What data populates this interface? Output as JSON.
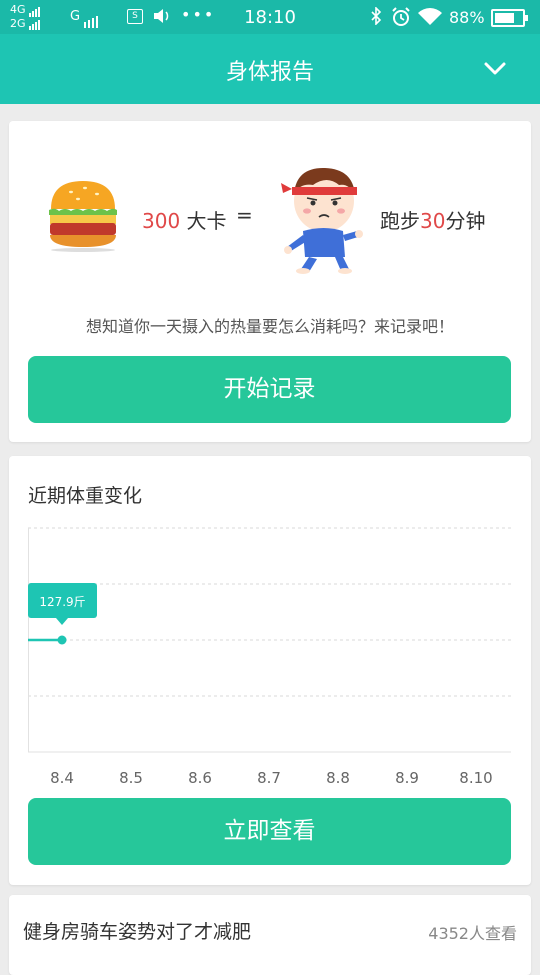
{
  "status_bar": {
    "net1": "4G",
    "net2": "2G",
    "carrier_g": "G",
    "sim_icon": "S",
    "more": "•••",
    "time": "18:10",
    "battery_pct": "88%",
    "battery_level": 0.88
  },
  "header": {
    "title": "身体报告",
    "chevron_icon": "chevron-down-icon"
  },
  "calorie_card": {
    "kcal_value": "300",
    "kcal_unit": "大卡",
    "equals": "=",
    "run_prefix": "跑步",
    "run_minutes": "30",
    "run_unit": "分钟",
    "prompt": "想知道你一天摄入的热量要怎么消耗吗？来记录吧！",
    "button": "开始记录"
  },
  "weight_card": {
    "title": "近期体重变化",
    "button": "立即查看"
  },
  "chart_data": {
    "type": "line",
    "title": "近期体重变化",
    "categories": [
      "8.4",
      "8.5",
      "8.6",
      "8.7",
      "8.8",
      "8.9",
      "8.10"
    ],
    "series": [
      {
        "values": [
          127.9,
          null,
          null,
          null,
          null,
          null,
          null
        ]
      }
    ],
    "data_labels": [
      "127.9斤"
    ],
    "grid": true,
    "accent": "#1ec5b3"
  },
  "article": {
    "title": "健身房骑车姿势对了才减肥",
    "views": "4352人查看"
  },
  "colors": {
    "header": "#1ec5b3",
    "button": "#26c79a",
    "highlight": "#e04848"
  }
}
